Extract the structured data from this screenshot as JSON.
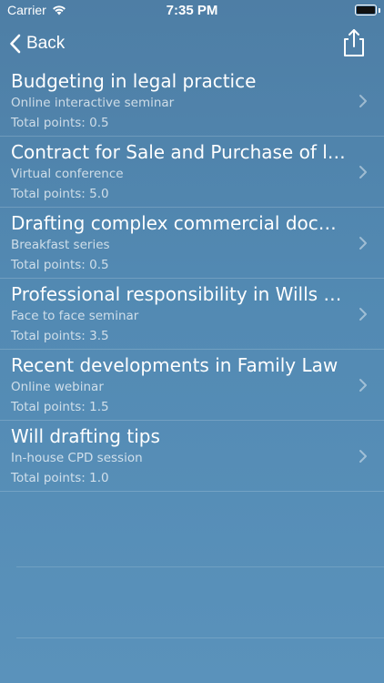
{
  "status": {
    "carrier": "Carrier",
    "time": "7:35 PM",
    "icons": [
      "wifi-icon",
      "battery-icon"
    ]
  },
  "nav": {
    "back_label": "Back",
    "icons": [
      "chevron-left-icon",
      "share-icon"
    ]
  },
  "items": [
    {
      "title": "Budgeting in legal practice",
      "subtitle": "Online interactive seminar",
      "points": "Total points: 0.5"
    },
    {
      "title": "Contract for Sale and Purchase of land",
      "subtitle": "Virtual conference",
      "points": "Total points: 5.0"
    },
    {
      "title": "Drafting complex commercial documents",
      "subtitle": "Breakfast series",
      "points": "Total points: 0.5"
    },
    {
      "title": "Professional responsibility in Wills & Estates",
      "subtitle": "Face to face seminar",
      "points": "Total points: 3.5"
    },
    {
      "title": "Recent developments in Family Law",
      "subtitle": "Online webinar",
      "points": "Total points: 1.5"
    },
    {
      "title": "Will drafting tips",
      "subtitle": "In-house CPD session",
      "points": "Total points: 1.0"
    }
  ],
  "colors": {
    "background": "#5289b2",
    "text": "#ffffff",
    "secondary_text": "#cfdde9"
  }
}
